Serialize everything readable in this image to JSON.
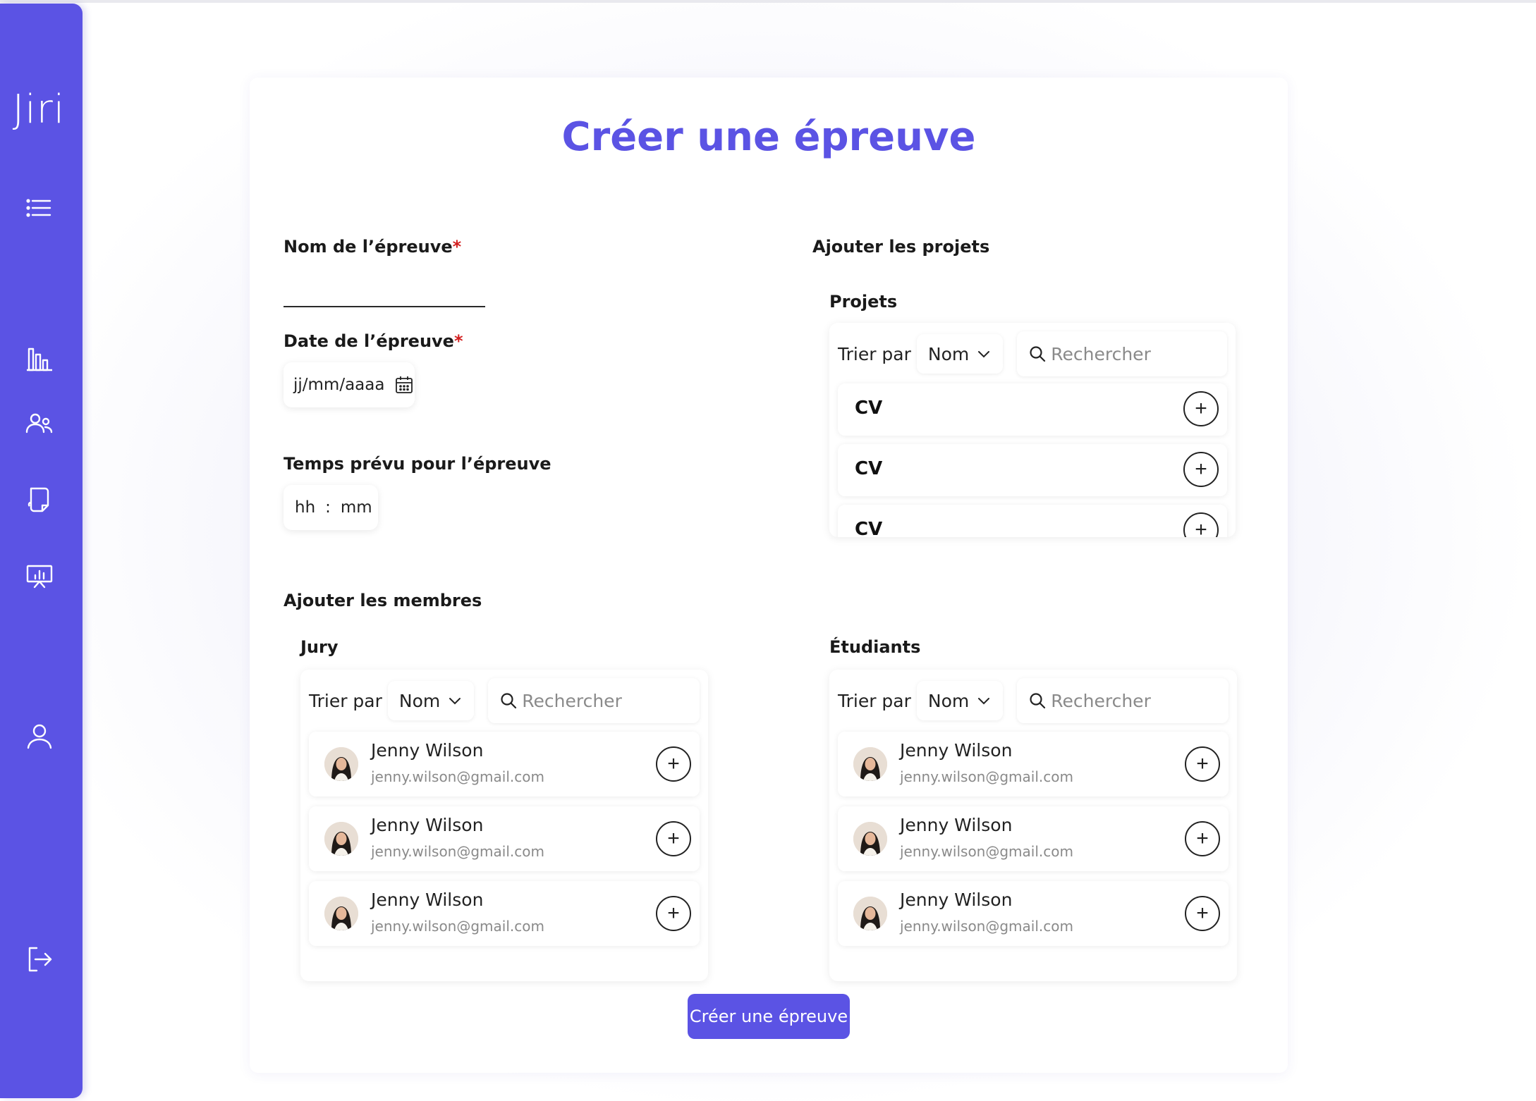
{
  "app": {
    "logo": "Jiri",
    "accent_color": "#5b53e4"
  },
  "sidebar": {
    "items": [
      {
        "icon": "menu-list-icon"
      },
      {
        "icon": "bar-chart-icon"
      },
      {
        "icon": "users-icon"
      },
      {
        "icon": "document-icon"
      },
      {
        "icon": "presentation-icon"
      },
      {
        "icon": "user-profile-icon"
      },
      {
        "icon": "logout-icon"
      }
    ]
  },
  "page": {
    "title": "Créer une épreuve"
  },
  "form": {
    "name_label": "Nom de l’épreuve",
    "date_label": "Date de l’épreuve",
    "date_placeholder": "jj/mm/aaaa",
    "duration_label": "Temps prévu pour l’épreuve",
    "duration_hh": "hh",
    "duration_sep": ":",
    "duration_mm": "mm",
    "required_mark": "*"
  },
  "projects": {
    "section_title": "Ajouter les projets",
    "panel_title": "Projets",
    "sort_label": "Trier par",
    "sort_value": "Nom",
    "search_placeholder": "Rechercher",
    "items": [
      {
        "name": "CV"
      },
      {
        "name": "CV"
      },
      {
        "name": "CV"
      }
    ]
  },
  "members": {
    "section_title": "Ajouter les membres",
    "jury": {
      "panel_title": "Jury",
      "sort_label": "Trier par",
      "sort_value": "Nom",
      "search_placeholder": "Rechercher",
      "items": [
        {
          "name": "Jenny Wilson",
          "email": "jenny.wilson@gmail.com"
        },
        {
          "name": "Jenny Wilson",
          "email": "jenny.wilson@gmail.com"
        },
        {
          "name": "Jenny Wilson",
          "email": "jenny.wilson@gmail.com"
        }
      ]
    },
    "students": {
      "panel_title": "Étudiants",
      "sort_label": "Trier par",
      "sort_value": "Nom",
      "search_placeholder": "Rechercher",
      "items": [
        {
          "name": "Jenny Wilson",
          "email": "jenny.wilson@gmail.com"
        },
        {
          "name": "Jenny Wilson",
          "email": "jenny.wilson@gmail.com"
        },
        {
          "name": "Jenny Wilson",
          "email": "jenny.wilson@gmail.com"
        }
      ]
    }
  },
  "actions": {
    "add_symbol": "+",
    "submit_label": "Créer une épreuve"
  }
}
